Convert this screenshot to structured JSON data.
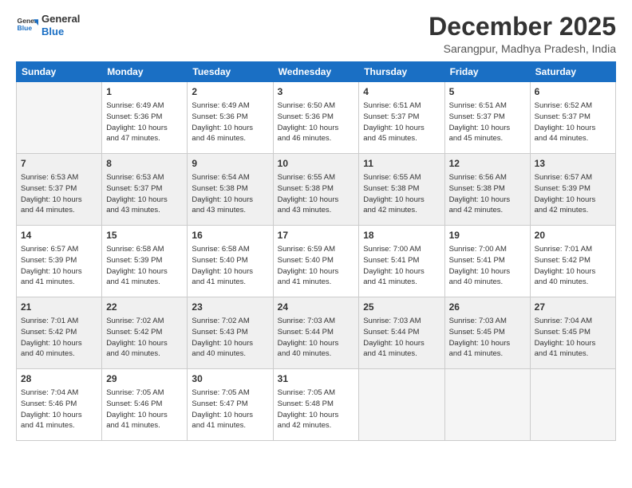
{
  "header": {
    "logo_line1": "General",
    "logo_line2": "Blue",
    "month": "December 2025",
    "location": "Sarangpur, Madhya Pradesh, India"
  },
  "weekdays": [
    "Sunday",
    "Monday",
    "Tuesday",
    "Wednesday",
    "Thursday",
    "Friday",
    "Saturday"
  ],
  "weeks": [
    [
      {
        "day": "",
        "info": ""
      },
      {
        "day": "1",
        "info": "Sunrise: 6:49 AM\nSunset: 5:36 PM\nDaylight: 10 hours\nand 47 minutes."
      },
      {
        "day": "2",
        "info": "Sunrise: 6:49 AM\nSunset: 5:36 PM\nDaylight: 10 hours\nand 46 minutes."
      },
      {
        "day": "3",
        "info": "Sunrise: 6:50 AM\nSunset: 5:36 PM\nDaylight: 10 hours\nand 46 minutes."
      },
      {
        "day": "4",
        "info": "Sunrise: 6:51 AM\nSunset: 5:37 PM\nDaylight: 10 hours\nand 45 minutes."
      },
      {
        "day": "5",
        "info": "Sunrise: 6:51 AM\nSunset: 5:37 PM\nDaylight: 10 hours\nand 45 minutes."
      },
      {
        "day": "6",
        "info": "Sunrise: 6:52 AM\nSunset: 5:37 PM\nDaylight: 10 hours\nand 44 minutes."
      }
    ],
    [
      {
        "day": "7",
        "info": "Sunrise: 6:53 AM\nSunset: 5:37 PM\nDaylight: 10 hours\nand 44 minutes."
      },
      {
        "day": "8",
        "info": "Sunrise: 6:53 AM\nSunset: 5:37 PM\nDaylight: 10 hours\nand 43 minutes."
      },
      {
        "day": "9",
        "info": "Sunrise: 6:54 AM\nSunset: 5:38 PM\nDaylight: 10 hours\nand 43 minutes."
      },
      {
        "day": "10",
        "info": "Sunrise: 6:55 AM\nSunset: 5:38 PM\nDaylight: 10 hours\nand 43 minutes."
      },
      {
        "day": "11",
        "info": "Sunrise: 6:55 AM\nSunset: 5:38 PM\nDaylight: 10 hours\nand 42 minutes."
      },
      {
        "day": "12",
        "info": "Sunrise: 6:56 AM\nSunset: 5:38 PM\nDaylight: 10 hours\nand 42 minutes."
      },
      {
        "day": "13",
        "info": "Sunrise: 6:57 AM\nSunset: 5:39 PM\nDaylight: 10 hours\nand 42 minutes."
      }
    ],
    [
      {
        "day": "14",
        "info": "Sunrise: 6:57 AM\nSunset: 5:39 PM\nDaylight: 10 hours\nand 41 minutes."
      },
      {
        "day": "15",
        "info": "Sunrise: 6:58 AM\nSunset: 5:39 PM\nDaylight: 10 hours\nand 41 minutes."
      },
      {
        "day": "16",
        "info": "Sunrise: 6:58 AM\nSunset: 5:40 PM\nDaylight: 10 hours\nand 41 minutes."
      },
      {
        "day": "17",
        "info": "Sunrise: 6:59 AM\nSunset: 5:40 PM\nDaylight: 10 hours\nand 41 minutes."
      },
      {
        "day": "18",
        "info": "Sunrise: 7:00 AM\nSunset: 5:41 PM\nDaylight: 10 hours\nand 41 minutes."
      },
      {
        "day": "19",
        "info": "Sunrise: 7:00 AM\nSunset: 5:41 PM\nDaylight: 10 hours\nand 40 minutes."
      },
      {
        "day": "20",
        "info": "Sunrise: 7:01 AM\nSunset: 5:42 PM\nDaylight: 10 hours\nand 40 minutes."
      }
    ],
    [
      {
        "day": "21",
        "info": "Sunrise: 7:01 AM\nSunset: 5:42 PM\nDaylight: 10 hours\nand 40 minutes."
      },
      {
        "day": "22",
        "info": "Sunrise: 7:02 AM\nSunset: 5:42 PM\nDaylight: 10 hours\nand 40 minutes."
      },
      {
        "day": "23",
        "info": "Sunrise: 7:02 AM\nSunset: 5:43 PM\nDaylight: 10 hours\nand 40 minutes."
      },
      {
        "day": "24",
        "info": "Sunrise: 7:03 AM\nSunset: 5:44 PM\nDaylight: 10 hours\nand 40 minutes."
      },
      {
        "day": "25",
        "info": "Sunrise: 7:03 AM\nSunset: 5:44 PM\nDaylight: 10 hours\nand 41 minutes."
      },
      {
        "day": "26",
        "info": "Sunrise: 7:03 AM\nSunset: 5:45 PM\nDaylight: 10 hours\nand 41 minutes."
      },
      {
        "day": "27",
        "info": "Sunrise: 7:04 AM\nSunset: 5:45 PM\nDaylight: 10 hours\nand 41 minutes."
      }
    ],
    [
      {
        "day": "28",
        "info": "Sunrise: 7:04 AM\nSunset: 5:46 PM\nDaylight: 10 hours\nand 41 minutes."
      },
      {
        "day": "29",
        "info": "Sunrise: 7:05 AM\nSunset: 5:46 PM\nDaylight: 10 hours\nand 41 minutes."
      },
      {
        "day": "30",
        "info": "Sunrise: 7:05 AM\nSunset: 5:47 PM\nDaylight: 10 hours\nand 41 minutes."
      },
      {
        "day": "31",
        "info": "Sunrise: 7:05 AM\nSunset: 5:48 PM\nDaylight: 10 hours\nand 42 minutes."
      },
      {
        "day": "",
        "info": ""
      },
      {
        "day": "",
        "info": ""
      },
      {
        "day": "",
        "info": ""
      }
    ]
  ]
}
